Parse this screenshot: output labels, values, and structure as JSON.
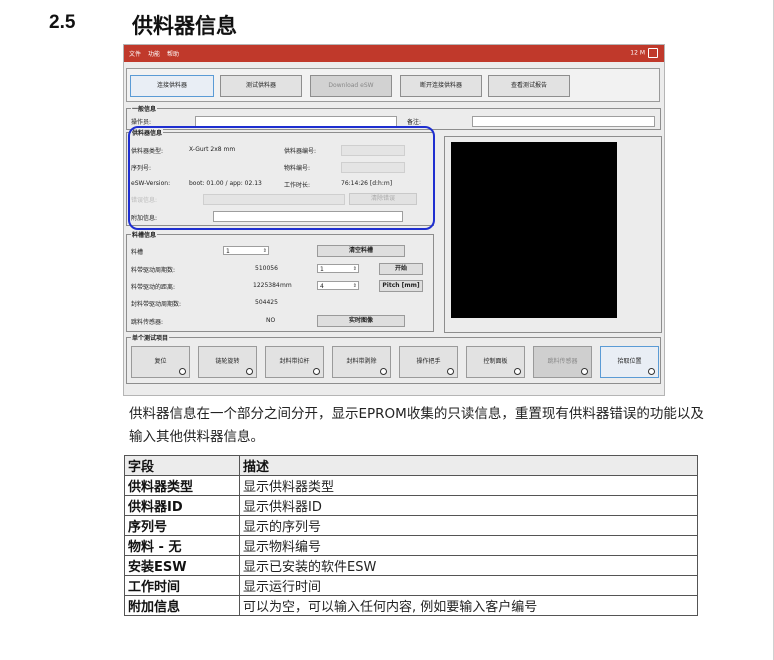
{
  "section": {
    "number": "2.5",
    "title": "供料器信息"
  },
  "screenshot": {
    "menu": [
      "文件",
      "功能",
      "帮助"
    ],
    "titlebar_right": "12 M",
    "toolbar_buttons": [
      {
        "label": "连接供料器",
        "state": "selected"
      },
      {
        "label": "测试供料器",
        "state": "normal"
      },
      {
        "label": "Download eSW",
        "state": "disabled"
      },
      {
        "label": "断开连接供料器",
        "state": "normal"
      },
      {
        "label": "查看测试报告",
        "state": "normal"
      }
    ],
    "general": {
      "title": "一般信息",
      "operator_label": "操作员:",
      "note_label": "备注:"
    },
    "feeder_info": {
      "title": "供料器信息",
      "type_label": "供料器类型:",
      "type_value": "X-Gurt 2x8 mm",
      "id_label": "供料器编号:",
      "serial_label": "序列号:",
      "material_label": "物料编号:",
      "esw_label": "eSW-Version:",
      "esw_value": "boot: 01.00 / app: 02.13",
      "runtime_label": "工作时长:",
      "runtime_value": "76:14:26 [d:h:m]",
      "error_label": "错误信息:",
      "error_button": "清除错误",
      "extra_label": "附加信息:"
    },
    "slot_info": {
      "title": "料槽信息",
      "slot_label": "料槽",
      "slot_value": "1",
      "clear_slot_button": "清空料槽",
      "cycles_label": "料带驱动周期数:",
      "cycles_value": "510056",
      "cycles_spin": "1",
      "start_button": "开始",
      "distance_label": "料带驱动的距离:",
      "distance_value": "1225384",
      "distance_unit": "mm",
      "distance_spin": "4",
      "pitch_button": "Pitch [mm]",
      "cover_cycles_label": "封料带驱动周期数:",
      "cover_cycles_value": "504425",
      "sensor_label": "跳料传感器:",
      "sensor_value": "NO",
      "live_button": "实时图像"
    },
    "single_test": {
      "title": "单个测试项目",
      "buttons": [
        {
          "label": "复位",
          "state": "normal"
        },
        {
          "label": "链轮旋转",
          "state": "normal"
        },
        {
          "label": "封料带拉杆",
          "state": "normal"
        },
        {
          "label": "封料带剥除",
          "state": "normal"
        },
        {
          "label": "操作把手",
          "state": "normal"
        },
        {
          "label": "控制面板",
          "state": "normal"
        },
        {
          "label": "跳料传感器",
          "state": "disabled"
        },
        {
          "label": "拾取位置",
          "state": "selected"
        }
      ]
    }
  },
  "paragraph": "供料器信息在一个部分之间分开，显示EPROM收集的只读信息，重置现有供料器错误的功能以及输入其他供料器信息。",
  "table": {
    "headers": [
      "字段",
      "描述"
    ],
    "rows": [
      [
        "供料器类型",
        "显示供料器类型"
      ],
      [
        "供料器ID",
        "显示供料器ID"
      ],
      [
        "序列号",
        "显示的序列号"
      ],
      [
        "物料 - 无",
        "显示物料编号"
      ],
      [
        "安装ESW",
        "显示已安装的软件ESW"
      ],
      [
        "工作时间",
        "显示运行时间"
      ],
      [
        "附加信息",
        "可以为空，可以输入任何内容, 例如要输入客户编号"
      ]
    ]
  }
}
